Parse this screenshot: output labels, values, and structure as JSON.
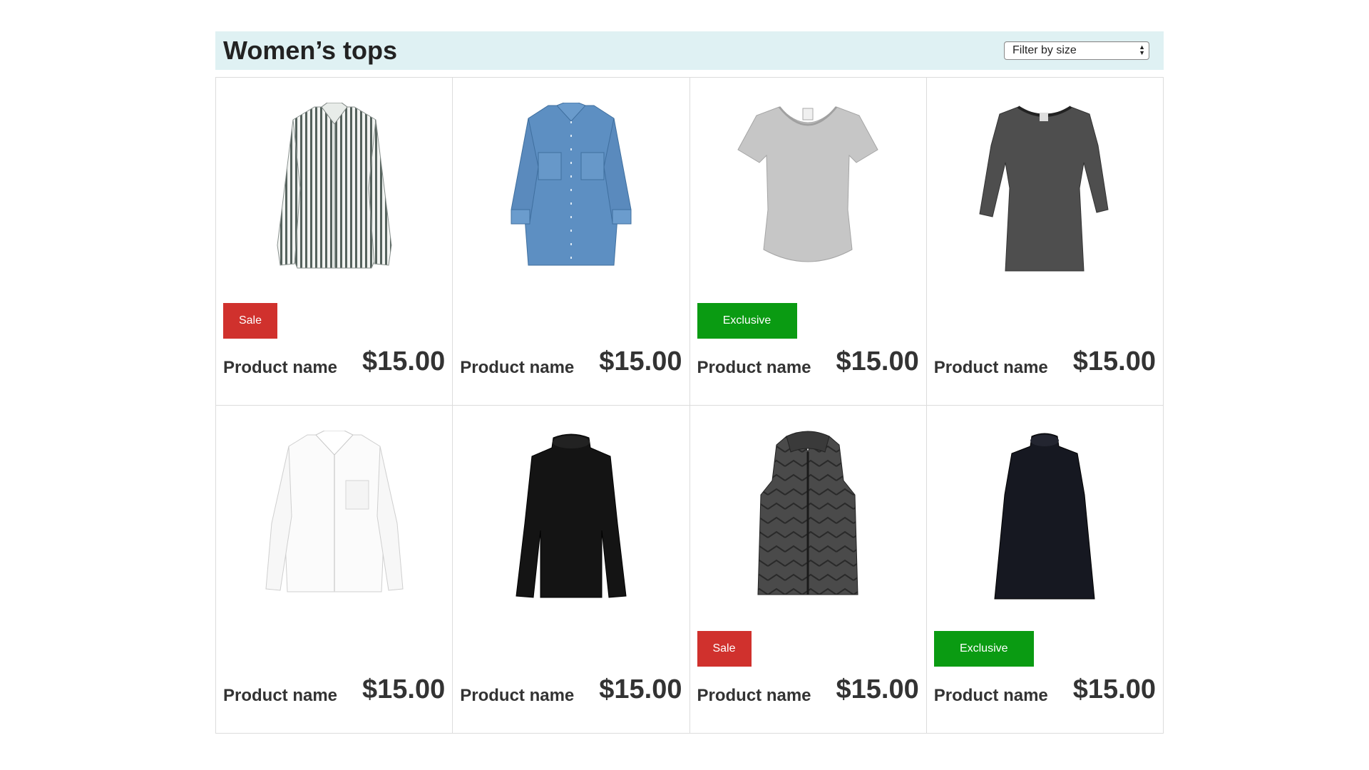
{
  "header": {
    "title": "Women’s tops",
    "filter_label": "Filter by size"
  },
  "products": [
    {
      "name": "Product name",
      "price": "$15.00",
      "badge": "Sale",
      "badge_type": "sale",
      "image": "striped-shirt"
    },
    {
      "name": "Product name",
      "price": "$15.00",
      "badge": "",
      "badge_type": "",
      "image": "denim-shirt"
    },
    {
      "name": "Product name",
      "price": "$15.00",
      "badge": "Exclusive",
      "badge_type": "exclusive",
      "image": "grey-tshirt"
    },
    {
      "name": "Product name",
      "price": "$15.00",
      "badge": "",
      "badge_type": "",
      "image": "charcoal-tunic"
    },
    {
      "name": "Product name",
      "price": "$15.00",
      "badge": "",
      "badge_type": "",
      "image": "white-shirt"
    },
    {
      "name": "Product name",
      "price": "$15.00",
      "badge": "",
      "badge_type": "",
      "image": "black-turtleneck"
    },
    {
      "name": "Product name",
      "price": "$15.00",
      "badge": "Sale",
      "badge_type": "sale",
      "image": "quilted-vest"
    },
    {
      "name": "Product name",
      "price": "$15.00",
      "badge": "Exclusive",
      "badge_type": "exclusive",
      "image": "black-swing-top"
    }
  ],
  "colors": {
    "header_bg": "#dff1f3",
    "sale": "#d0312d",
    "exclusive": "#0a9b12",
    "text": "#333333"
  }
}
